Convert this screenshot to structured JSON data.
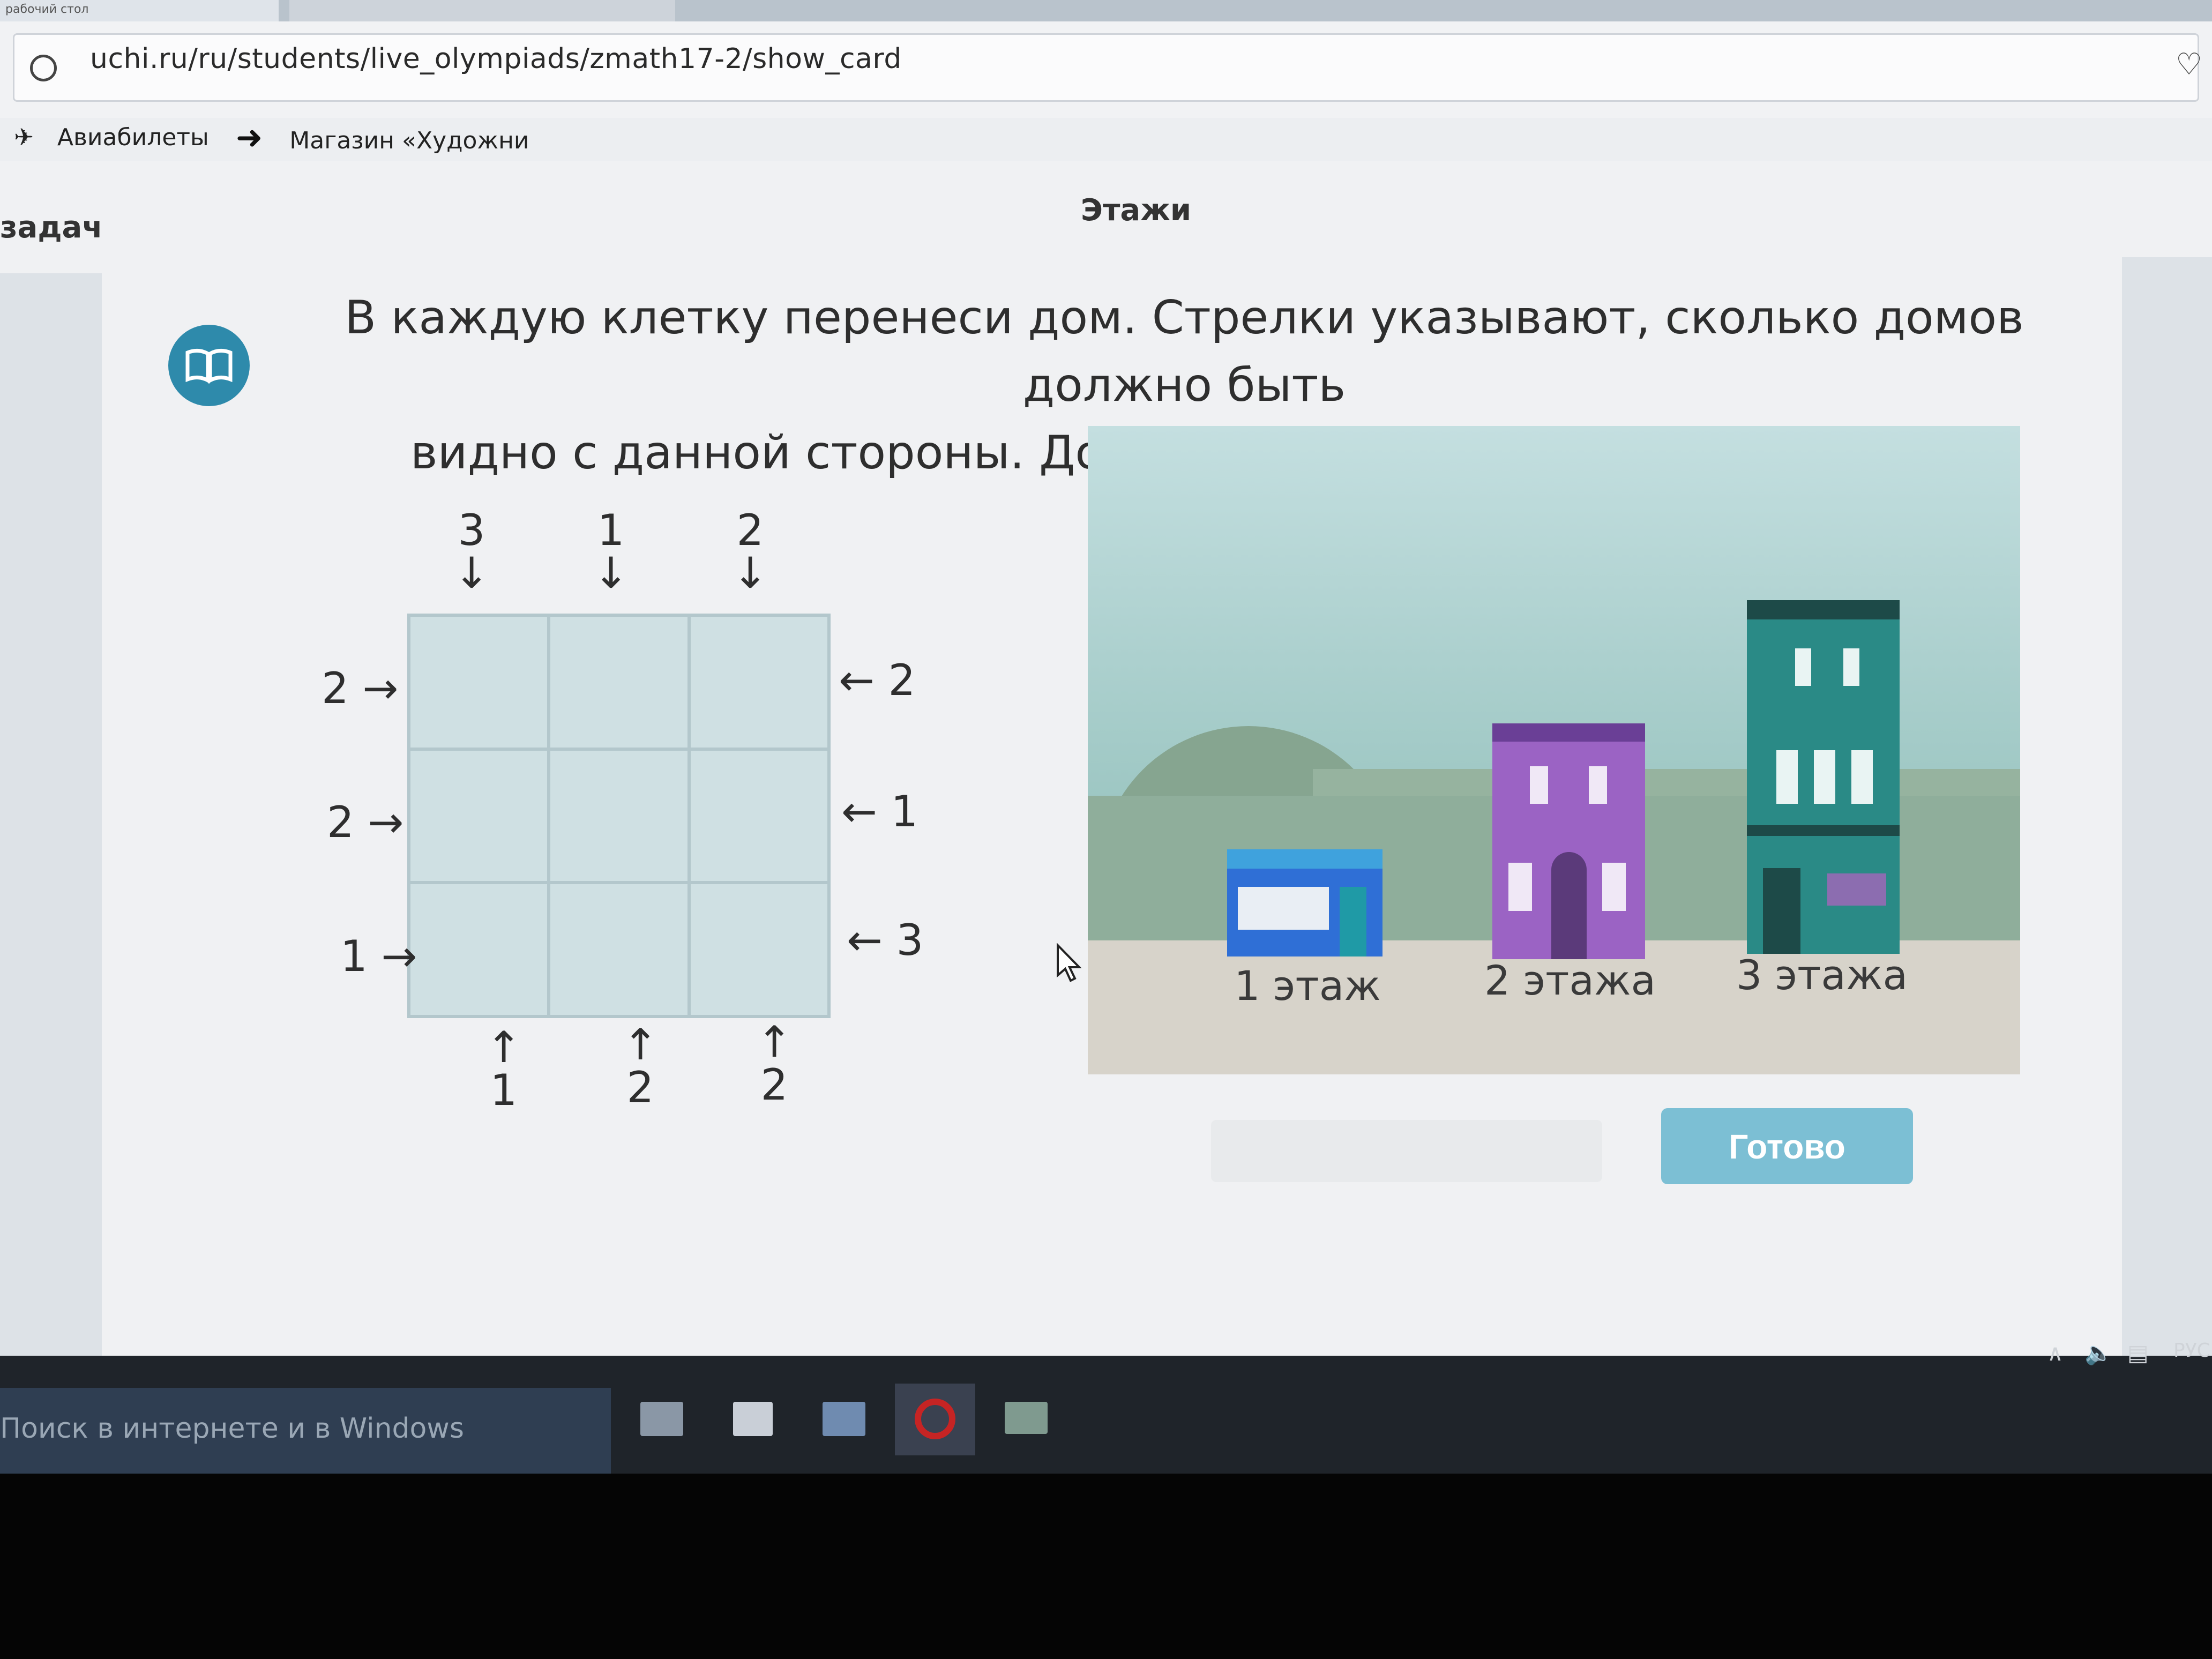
{
  "browser": {
    "tab_label": "рабочий стол",
    "url": "uchi.ru/ru/students/live_olympiads/zmath17-2/show_card",
    "bookmarks": [
      {
        "label": "Авиабилеты",
        "icon": "plane-icon"
      },
      {
        "label": "Магазин «Художни",
        "icon": "arrow-right-icon"
      }
    ]
  },
  "page": {
    "sidebar_label": "задач",
    "title": "Этажи",
    "instruction_line1": "В каждую клетку перенеси дом. Стрелки указывают, сколько домов должно быть",
    "instruction_line2": "видно с данной стороны. Дома в ряду не должны повторяться."
  },
  "puzzle": {
    "top": [
      {
        "n": "3",
        "a": "↓"
      },
      {
        "n": "1",
        "a": "↓"
      },
      {
        "n": "2",
        "a": "↓"
      }
    ],
    "bottom": [
      {
        "n": "1",
        "a": "↑"
      },
      {
        "n": "2",
        "a": "↑"
      },
      {
        "n": "2",
        "a": "↑"
      }
    ],
    "left": [
      {
        "n": "2",
        "a": "→"
      },
      {
        "n": "2",
        "a": "→"
      },
      {
        "n": "1",
        "a": "→"
      }
    ],
    "right": [
      {
        "n": "2",
        "a": "←"
      },
      {
        "n": "1",
        "a": "←"
      },
      {
        "n": "3",
        "a": "←"
      }
    ]
  },
  "buildings": [
    {
      "label": "1 этаж",
      "color": "#2f6fd6"
    },
    {
      "label": "2 этажа",
      "color": "#9b63c4"
    },
    {
      "label": "3 этажа",
      "color": "#2a8a86"
    }
  ],
  "actions": {
    "ready_label": "Готово"
  },
  "taskbar": {
    "search_placeholder": "Поиск в интернете и в Windows",
    "language": "РУС"
  }
}
